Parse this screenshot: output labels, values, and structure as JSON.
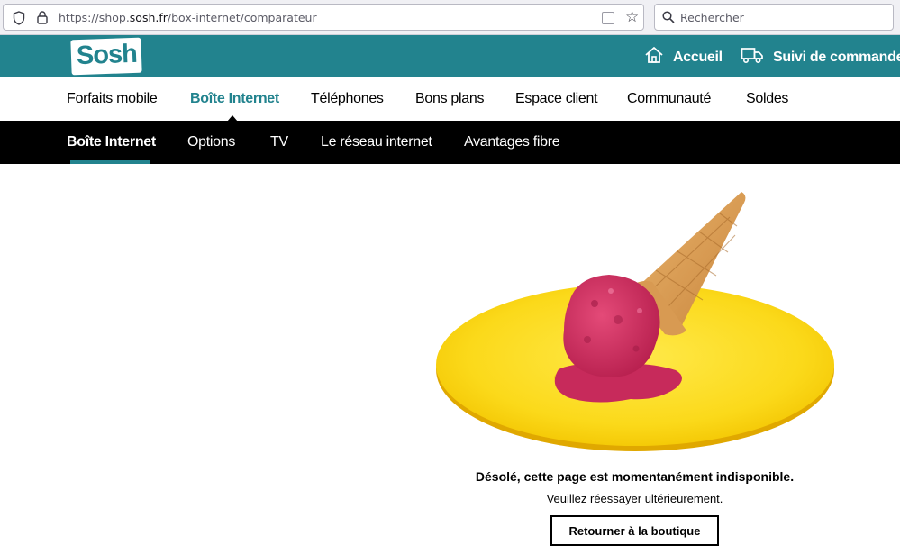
{
  "browser": {
    "url_prefix": "https://shop.",
    "url_domain": "sosh.fr",
    "url_path": "/box-internet/comparateur",
    "search_placeholder": "Rechercher"
  },
  "header": {
    "logo_text": "Sosh",
    "home_label": "Accueil",
    "order_label": "Suivi de commande",
    "brand_color": "#22838e"
  },
  "main_nav": {
    "items": [
      {
        "label": "Forfaits mobile"
      },
      {
        "label": "Boîte Internet",
        "active": true
      },
      {
        "label": "Téléphones"
      },
      {
        "label": "Bons plans"
      },
      {
        "label": "Espace client"
      },
      {
        "label": "Communauté"
      },
      {
        "label": "Soldes"
      }
    ]
  },
  "sub_nav": {
    "items": [
      {
        "label": "Boîte Internet",
        "active": true
      },
      {
        "label": "Options"
      },
      {
        "label": "TV"
      },
      {
        "label": "Le réseau internet"
      },
      {
        "label": "Avantages fibre"
      }
    ]
  },
  "error": {
    "title": "Désolé, cette page est momentanément indisponible.",
    "subtitle": "Veuillez réessayer ultérieurement.",
    "button_label": "Retourner à la boutique"
  },
  "icons": {
    "url_shield": "shield-icon",
    "url_lock": "lock-icon",
    "bookmark": "star-icon",
    "search": "search-icon",
    "home": "home-icon",
    "delivery": "truck-icon"
  },
  "illustration": "melted-ice-cream-cone-on-yellow-disc"
}
